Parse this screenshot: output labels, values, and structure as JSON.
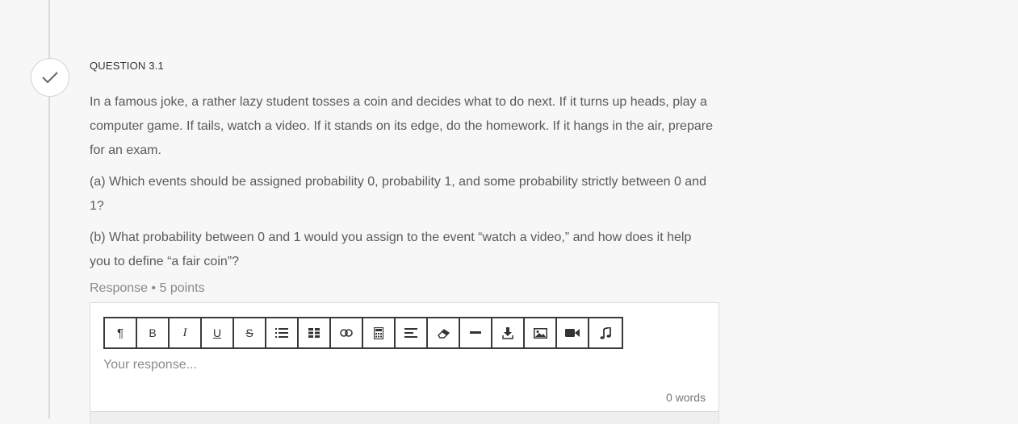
{
  "question": {
    "label": "QUESTION 3.1",
    "paragraph1": "In a famous joke, a rather lazy student tosses a coin and decides what to do next. If it turns up heads, play a computer game. If tails, watch a video. If it stands on its edge, do the homework. If it hangs in the air, prepare for an exam.",
    "paragraph2": "(a) Which events should be assigned probability 0, probability 1, and some probability strictly between 0 and 1?",
    "paragraph3": "(b) What probability between 0 and 1 would you assign to the event “watch a video,” and how does it help you to define “a fair coin”?",
    "points": "Response • 5 points"
  },
  "editor": {
    "placeholder": "Your response...",
    "word_count": "0 words",
    "toolbar": [
      {
        "name": "paragraph-button",
        "icon": "pilcrow-icon"
      },
      {
        "name": "bold-button",
        "icon": "bold-icon"
      },
      {
        "name": "italic-button",
        "icon": "italic-icon"
      },
      {
        "name": "underline-button",
        "icon": "underline-icon"
      },
      {
        "name": "strikethrough-button",
        "icon": "strikethrough-icon"
      },
      {
        "name": "bulleted-list-button",
        "icon": "list-icon"
      },
      {
        "name": "table-button",
        "icon": "table-icon"
      },
      {
        "name": "link-button",
        "icon": "link-icon"
      },
      {
        "name": "calculator-button",
        "icon": "calculator-icon"
      },
      {
        "name": "align-button",
        "icon": "align-left-icon"
      },
      {
        "name": "clear-format-button",
        "icon": "eraser-icon"
      },
      {
        "name": "horizontal-rule-button",
        "icon": "horizontal-rule-icon"
      },
      {
        "name": "download-button",
        "icon": "download-icon"
      },
      {
        "name": "image-button",
        "icon": "image-icon"
      },
      {
        "name": "video-button",
        "icon": "video-camera-icon"
      },
      {
        "name": "audio-button",
        "icon": "music-note-icon"
      }
    ]
  },
  "colors": {
    "background": "#f7f7f7",
    "toolbar_border": "#3a3a3a",
    "text": "#5a5a5a"
  }
}
